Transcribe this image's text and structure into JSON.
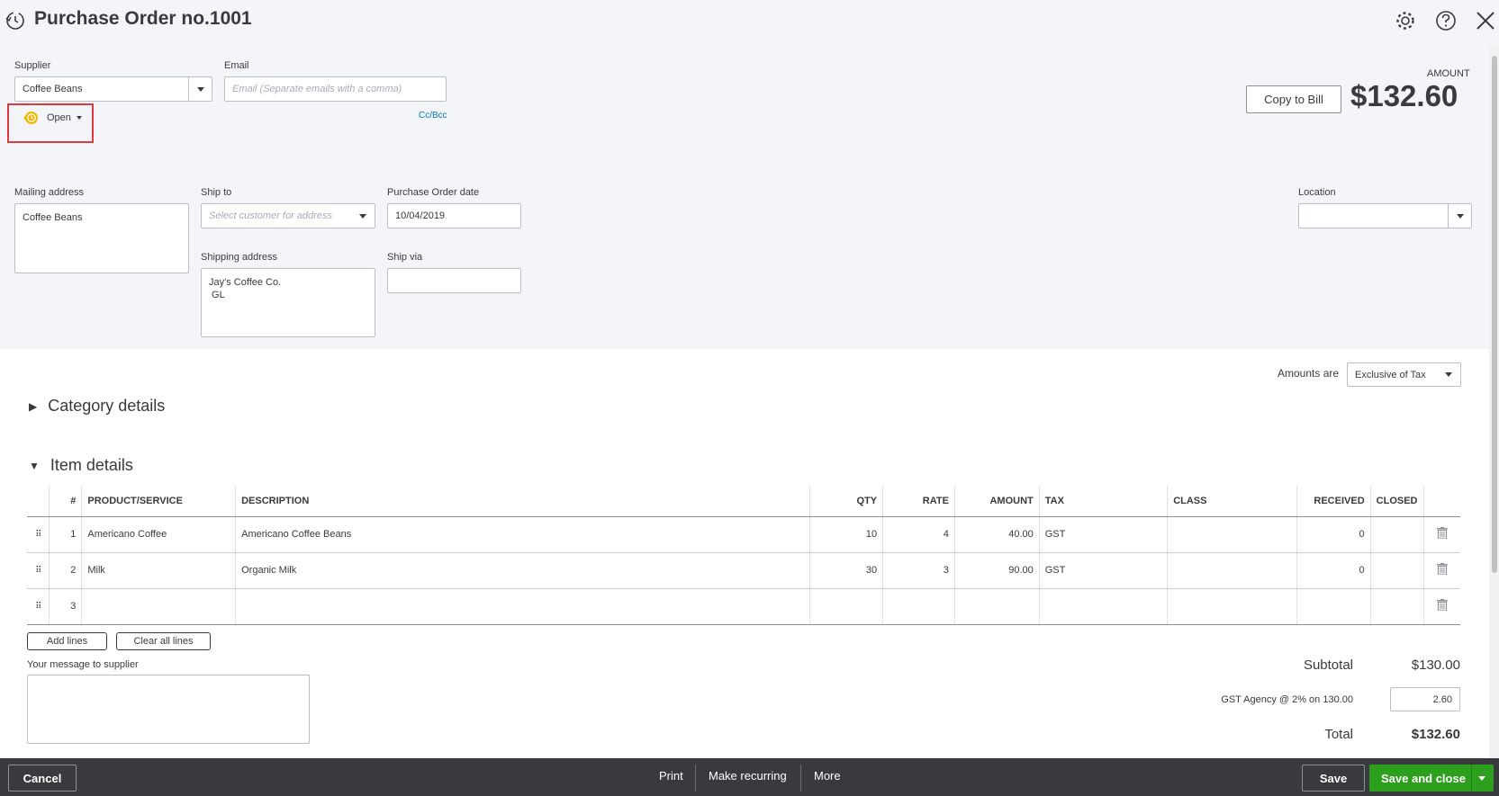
{
  "header": {
    "title": "Purchase Order no.1001",
    "icons": [
      "history-icon",
      "gear-icon",
      "help-icon",
      "close-icon"
    ]
  },
  "supplier": {
    "label": "Supplier",
    "value": "Coffee Beans"
  },
  "email": {
    "label": "Email",
    "placeholder": "Email (Separate emails with a comma)",
    "ccbcc": "Cc/Bcc"
  },
  "status": {
    "label": "Open"
  },
  "amount": {
    "label": "AMOUNT",
    "value": "$132.60",
    "copy_to_bill": "Copy to Bill"
  },
  "mailing_address": {
    "label": "Mailing address",
    "value": "Coffee Beans"
  },
  "ship_to": {
    "label": "Ship to",
    "placeholder": "Select customer for address"
  },
  "po_date": {
    "label": "Purchase Order date",
    "value": "10/04/2019"
  },
  "shipping_address": {
    "label": "Shipping address",
    "value": "Jay's Coffee Co.\n GL"
  },
  "ship_via": {
    "label": "Ship via",
    "value": ""
  },
  "location": {
    "label": "Location",
    "value": ""
  },
  "amounts_are": {
    "label": "Amounts are",
    "value": "Exclusive of Tax"
  },
  "sections": {
    "category": "Category details",
    "items": "Item details"
  },
  "table": {
    "headers": [
      "#",
      "PRODUCT/SERVICE",
      "DESCRIPTION",
      "QTY",
      "RATE",
      "AMOUNT",
      "TAX",
      "CLASS",
      "RECEIVED",
      "CLOSED"
    ],
    "rows": [
      {
        "num": "1",
        "product": "Americano Coffee",
        "description": "Americano Coffee Beans",
        "qty": "10",
        "rate": "4",
        "amount": "40.00",
        "tax": "GST",
        "class": "",
        "received": "0",
        "closed": ""
      },
      {
        "num": "2",
        "product": "Milk",
        "description": "Organic Milk",
        "qty": "30",
        "rate": "3",
        "amount": "90.00",
        "tax": "GST",
        "class": "",
        "received": "0",
        "closed": ""
      },
      {
        "num": "3",
        "product": "",
        "description": "",
        "qty": "",
        "rate": "",
        "amount": "",
        "tax": "",
        "class": "",
        "received": "",
        "closed": ""
      }
    ]
  },
  "actions": {
    "add_lines": "Add lines",
    "clear_all_lines": "Clear all lines"
  },
  "message": {
    "label": "Your message to supplier",
    "value": ""
  },
  "totals": {
    "subtotal_label": "Subtotal",
    "subtotal": "$130.00",
    "tax_label": "GST Agency @ 2% on 130.00",
    "tax_value": "2.60",
    "total_label": "Total",
    "total": "$132.60"
  },
  "footer": {
    "cancel": "Cancel",
    "print": "Print",
    "make_recurring": "Make recurring",
    "more": "More",
    "save": "Save",
    "save_and_close": "Save and close"
  },
  "colors": {
    "accent_green": "#2ca01c",
    "footer_bg": "#393a3d",
    "link_blue": "#0077c5",
    "status_orange": "#f2b600",
    "highlight_red": "#e0393e"
  }
}
